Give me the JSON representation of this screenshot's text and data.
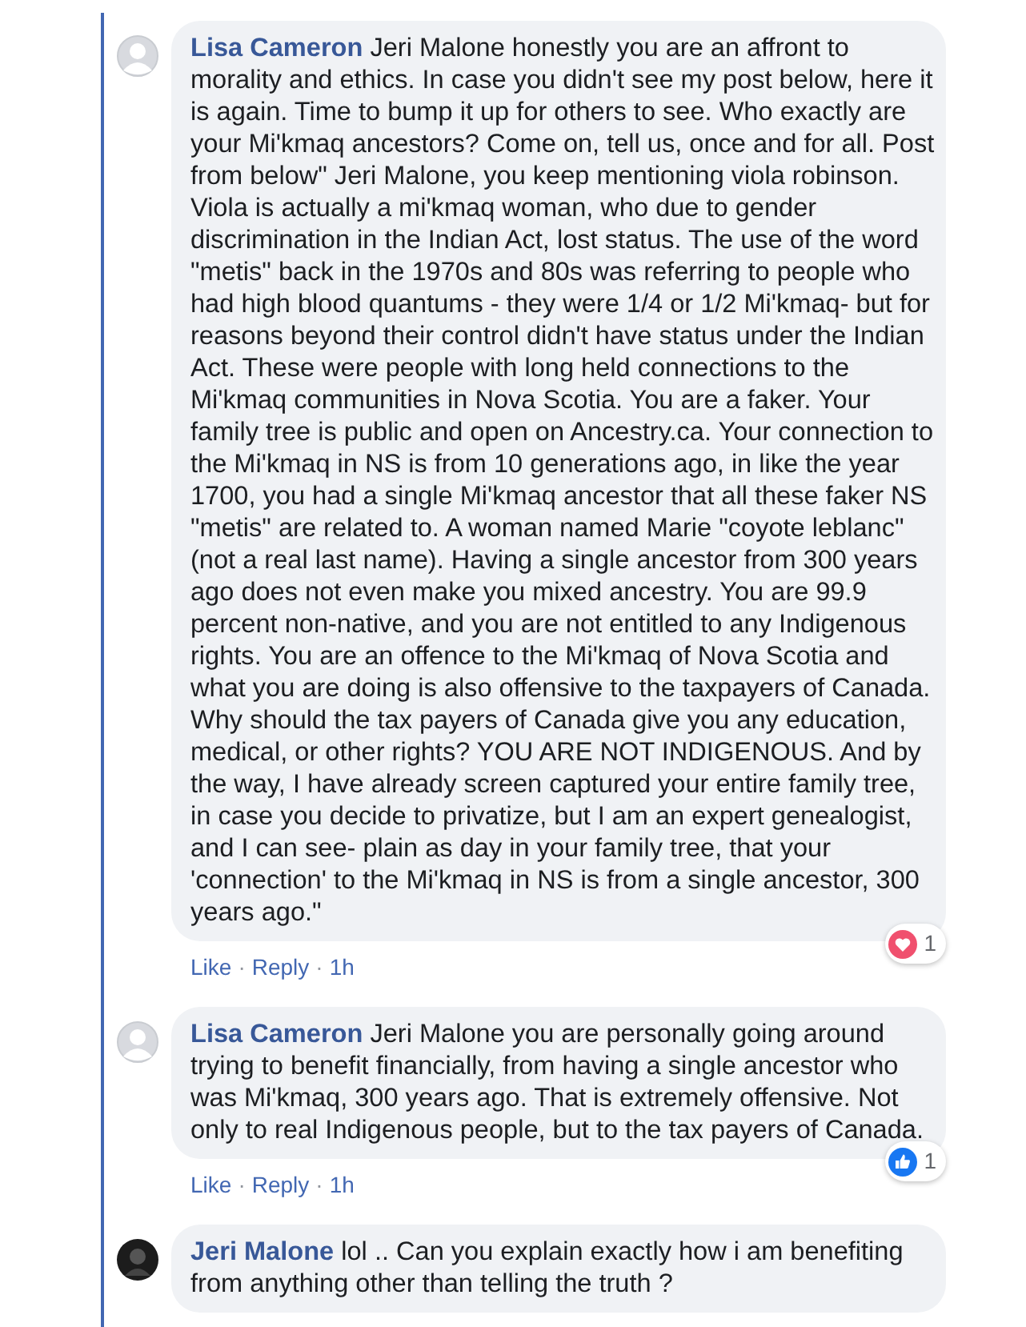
{
  "comments": [
    {
      "author": "Lisa Cameron",
      "avatar_photo": false,
      "text": "Jeri Malone honestly you are an affront to morality and ethics. In case you didn't see my post below, here it is again. Time to bump it up for others to see. Who exactly are your Mi'kmaq ancestors? Come on, tell us, once and for all. Post from below\" Jeri Malone, you keep mentioning viola robinson. Viola is actually a mi'kmaq woman, who due to gender discrimination in the Indian Act, lost status. The use of the word \"metis\" back in the 1970s and 80s was referring to people who had high blood quantums - they were 1/4 or 1/2 Mi'kmaq- but for reasons beyond their control didn't have status under the Indian Act. These were people with long held connections to the Mi'kmaq communities in Nova Scotia. You are a faker. Your family tree is public and open on Ancestry.ca. Your connection to the Mi'kmaq in NS is from 10 generations ago, in like the year 1700, you had a single Mi'kmaq ancestor that all these faker NS \"metis\" are related to. A woman named Marie \"coyote leblanc\" (not a real last name). Having a single ancestor from 300 years ago does not even make you mixed ancestry. You are 99.9 percent non-native, and you are not entitled to any Indigenous rights. You are an offence to the Mi'kmaq of Nova Scotia and what you are doing is also offensive to the taxpayers of Canada. Why should the tax payers of Canada give you any education, medical, or other rights? YOU ARE NOT INDIGENOUS. And by the way, I have already screen captured your entire family tree, in case you decide to privatize, but I am an expert genealogist, and I can see- plain as day in your family tree, that your 'connection' to the Mi'kmaq in NS is from a single ancestor, 300 years ago.\"",
      "actions": [
        {
          "kind": "link",
          "text": "Like"
        },
        {
          "kind": "separator",
          "text": "·"
        },
        {
          "kind": "link",
          "text": "Reply"
        },
        {
          "kind": "separator",
          "text": "·"
        },
        {
          "kind": "time",
          "text": "1h"
        }
      ],
      "reaction": {
        "kind": "love",
        "count": "1"
      }
    },
    {
      "author": "Lisa Cameron",
      "avatar_photo": false,
      "text": "Jeri Malone you are personally going around trying to benefit financially, from having a single ancestor who was Mi'kmaq, 300 years ago. That is extremely offensive. Not only to real Indigenous people, but to the tax payers of Canada.",
      "actions": [
        {
          "kind": "link",
          "text": "Like"
        },
        {
          "kind": "separator",
          "text": "·"
        },
        {
          "kind": "link",
          "text": "Reply"
        },
        {
          "kind": "separator",
          "text": "·"
        },
        {
          "kind": "time",
          "text": "1h"
        }
      ],
      "reaction": {
        "kind": "like",
        "count": "1"
      }
    },
    {
      "author": "Jeri Malone",
      "avatar_photo": true,
      "text": "lol .. Can you explain exactly how i am benefiting from anything other than telling the truth ?"
    }
  ]
}
